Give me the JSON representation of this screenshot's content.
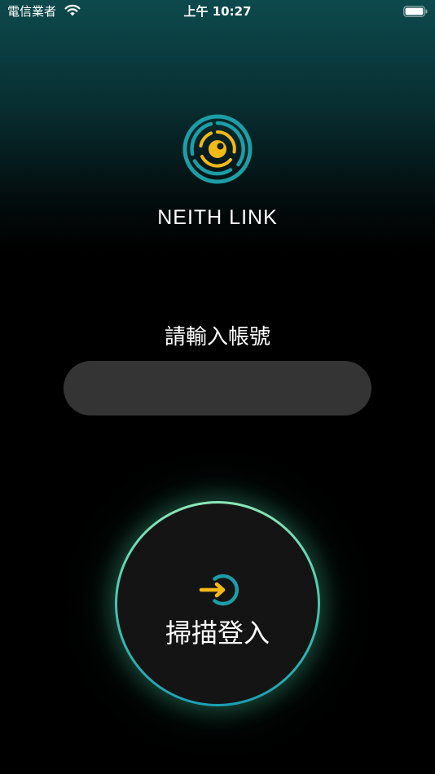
{
  "status_bar": {
    "carrier": "電信業者",
    "time": "上午 10:27"
  },
  "brand": {
    "name": "NEITH LINK"
  },
  "account": {
    "label": "請輸入帳號",
    "value": "",
    "placeholder": ""
  },
  "scan_login": {
    "label": "掃描登入"
  },
  "colors": {
    "brand_teal": "#1b9ea6",
    "brand_yellow": "#f5b915",
    "input_bg": "#343434",
    "ring_top": "#8de9b8",
    "ring_bottom": "#1aa0b5"
  },
  "icons": {
    "wifi": "wifi-icon",
    "battery": "battery-icon",
    "logo": "neith-eye-logo",
    "login": "login-arrow-icon"
  }
}
